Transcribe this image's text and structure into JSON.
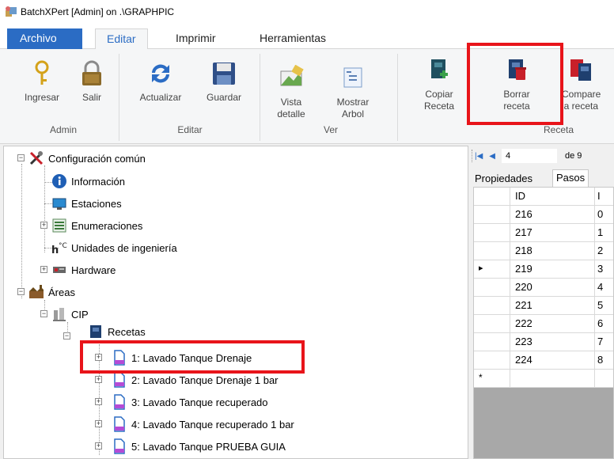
{
  "window": {
    "title": "BatchXPert [Admin] on .\\GRAPHPIC"
  },
  "ribbon_tabs": [
    "Archivo",
    "Editar",
    "Imprimir",
    "Herramientas"
  ],
  "ribbon": {
    "admin": {
      "ingresar": "Ingresar",
      "salir": "Salir",
      "label": "Admin"
    },
    "editar": {
      "actualizar": "Actualizar",
      "guardar": "Guardar",
      "label": "Editar"
    },
    "ver": {
      "vista_1": "Vista",
      "vista_2": "detalle",
      "mostrar_1": "Mostrar",
      "mostrar_2": "Arbol",
      "label": "Ver"
    },
    "receta": {
      "copiar_1": "Copiar",
      "copiar_2": "Receta",
      "borrar_1": "Borrar",
      "borrar_2": "receta",
      "compare_1": "Compare",
      "compare_2": "la receta",
      "label": "Receta"
    }
  },
  "tree": {
    "config": "Configuración común",
    "informacion": "Información",
    "estaciones": "Estaciones",
    "enumeraciones": "Enumeraciones",
    "unidades": "Unidades de ingeniería",
    "hardware": "Hardware",
    "areas": "Áreas",
    "cip": "CIP",
    "recetas": "Recetas",
    "items": [
      "1: Lavado Tanque Drenaje",
      "2: Lavado Tanque Drenaje 1 bar",
      "3: Lavado Tanque recuperado",
      "4: Lavado Tanque recuperado 1 bar",
      "5: Lavado Tanque PRUEBA GUIA"
    ]
  },
  "navigator": {
    "position": "4",
    "of_label": "de 9"
  },
  "panel_tabs": [
    "Propiedades",
    "Pasos"
  ],
  "grid": {
    "column_id": "ID",
    "column_2": "I",
    "rows": [
      {
        "id": "216",
        "v": "0"
      },
      {
        "id": "217",
        "v": "1"
      },
      {
        "id": "218",
        "v": "2"
      },
      {
        "id": "219",
        "v": "3"
      },
      {
        "id": "220",
        "v": "4"
      },
      {
        "id": "221",
        "v": "5"
      },
      {
        "id": "222",
        "v": "6"
      },
      {
        "id": "223",
        "v": "7"
      },
      {
        "id": "224",
        "v": "8"
      }
    ],
    "current_marker": "▸",
    "new_row_marker": "*"
  },
  "colors": {
    "accent": "#2b6cc4",
    "highlight": "#e8141a"
  }
}
